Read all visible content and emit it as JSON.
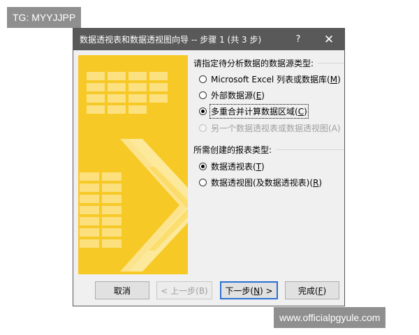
{
  "watermarks": {
    "top": "TG: MYYJJPP",
    "bottom": "www.officialpgyule.com"
  },
  "dialog": {
    "title": "数据透视表和数据透视图向导 -- 步骤 1 (共 3 步)",
    "help_glyph": "?",
    "close_glyph": "✕"
  },
  "source_group": {
    "label": "请指定待分析数据的数据源类型:",
    "options": [
      {
        "text": "Microsoft Excel 列表或数据库",
        "key": "M",
        "checked": false,
        "disabled": false
      },
      {
        "text": "外部数据源",
        "key": "E",
        "checked": false,
        "disabled": false
      },
      {
        "text": "多重合并计算数据区域",
        "key": "C",
        "checked": true,
        "disabled": false
      },
      {
        "text": "另一个数据透视表或数据透视图",
        "key": "A",
        "checked": false,
        "disabled": true
      }
    ]
  },
  "report_group": {
    "label": "所需创建的报表类型:",
    "options": [
      {
        "text": "数据透视表",
        "key": "T",
        "checked": true
      },
      {
        "text": "数据透视图(及数据透视表)",
        "key": "R",
        "checked": false
      }
    ]
  },
  "buttons": {
    "cancel": "取消",
    "back": "< 上一步(B)",
    "next_prefix": "下一步(",
    "next_key": "N",
    "next_suffix": ") >",
    "finish_prefix": "完成(",
    "finish_key": "F",
    "finish_suffix": ")"
  },
  "colors": {
    "graphic_bg": "#f6c314",
    "graphic_light": "#fce27a",
    "graphic_pale": "#fdf0b8",
    "titlebar": "#595959",
    "default_button_border": "#2c6fd1"
  }
}
